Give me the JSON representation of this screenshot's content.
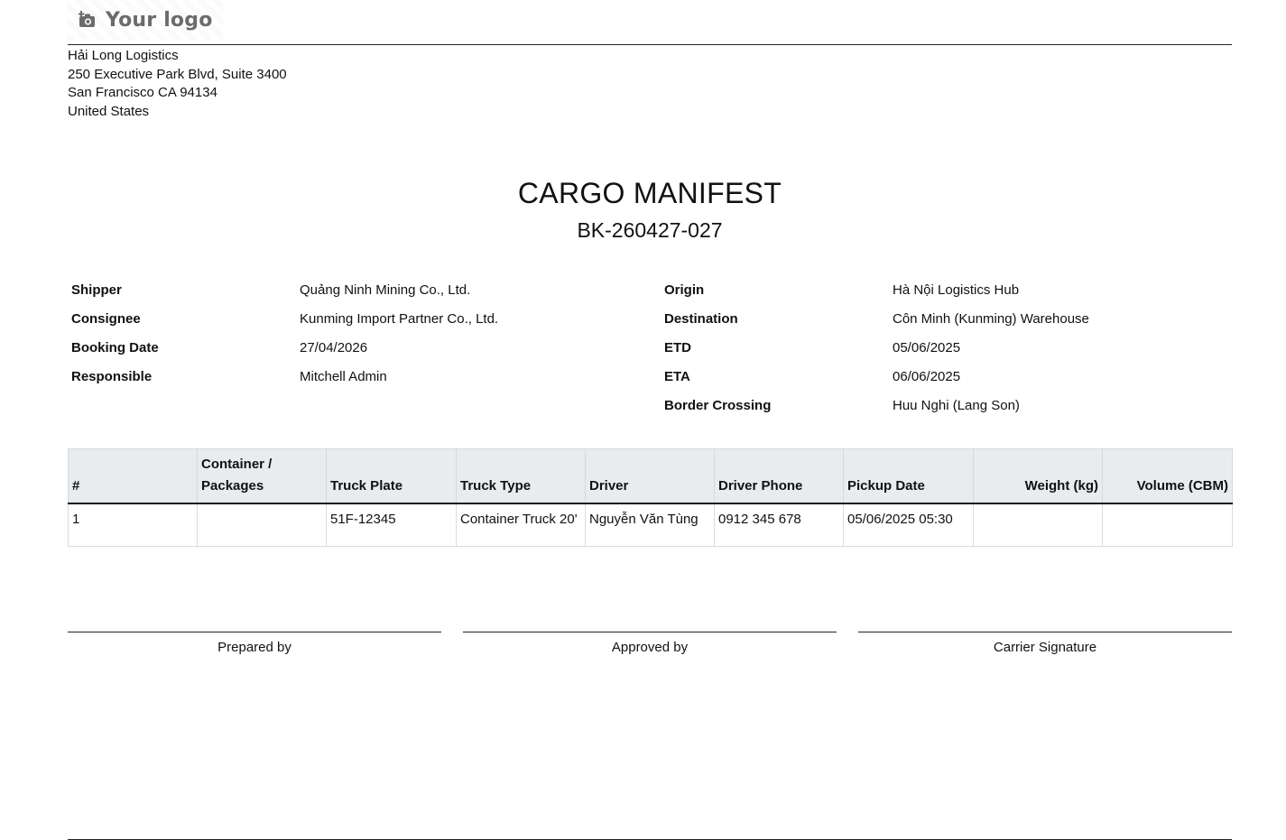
{
  "header": {
    "logo_text": "Your logo",
    "logo_icon": "camera-plus-icon"
  },
  "company": {
    "name": "Hải Long Logistics",
    "address_line1": "250 Executive Park Blvd, Suite 3400",
    "address_line2": "San Francisco CA 94134",
    "country": "United States"
  },
  "document": {
    "title": "CARGO MANIFEST",
    "reference": "BK-260427-027"
  },
  "info_left": [
    {
      "label": "Shipper",
      "value": "Quảng Ninh Mining Co., Ltd."
    },
    {
      "label": "Consignee",
      "value": "Kunming Import Partner Co., Ltd."
    },
    {
      "label": "Booking Date",
      "value": "27/04/2026"
    },
    {
      "label": "Responsible",
      "value": "Mitchell Admin"
    }
  ],
  "info_right": [
    {
      "label": "Origin",
      "value": "Hà Nội Logistics Hub"
    },
    {
      "label": "Destination",
      "value": "Côn Minh (Kunming) Warehouse"
    },
    {
      "label": "ETD",
      "value": "05/06/2025"
    },
    {
      "label": "ETA",
      "value": "06/06/2025"
    },
    {
      "label": "Border Crossing",
      "value": "Huu Nghi (Lang Son)"
    }
  ],
  "table": {
    "headers": [
      "#",
      "Container / Packages",
      "Truck Plate",
      "Truck Type",
      "Driver",
      "Driver Phone",
      "Pickup Date",
      "Weight (kg)",
      "Volume (CBM)"
    ],
    "rows": [
      [
        "1",
        "",
        "51F-12345",
        "Container Truck 20'",
        "Nguyễn Văn Tùng",
        "0912 345 678",
        "05/06/2025 05:30",
        "",
        ""
      ]
    ]
  },
  "signatures": {
    "prepared": "Prepared by",
    "approved": "Approved by",
    "carrier": "Carrier Signature"
  },
  "colors": {
    "table_header_bg": "#e9ecef",
    "logo_text": "#6b6b6b"
  }
}
